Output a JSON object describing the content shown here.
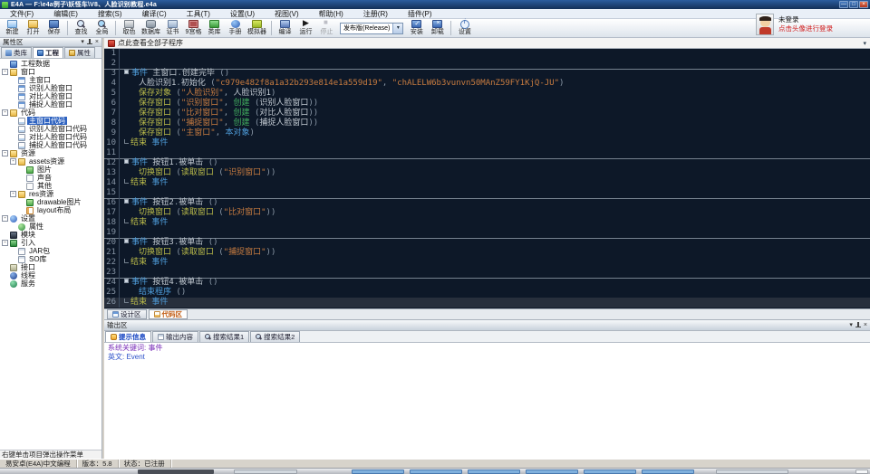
{
  "window": {
    "title": "E4A — F:\\e4a例子\\妖怪车\\V8、人脸识别教程.e4a"
  },
  "menu": {
    "items": [
      "文件(F)",
      "编辑(E)",
      "搜索(S)",
      "编译(C)",
      "工具(T)",
      "设置(U)",
      "视图(V)",
      "帮助(H)",
      "注册(R)",
      "插件(P)"
    ]
  },
  "toolbar": {
    "buttons": [
      {
        "label": "新建",
        "icon": "new"
      },
      {
        "label": "打开",
        "icon": "open"
      },
      {
        "label": "保存",
        "icon": "save"
      },
      {
        "sep": true
      },
      {
        "label": "查找",
        "icon": "find"
      },
      {
        "label": "全局",
        "icon": "global"
      },
      {
        "sep": true
      },
      {
        "label": "取色",
        "icon": "color"
      },
      {
        "label": "数据库",
        "icon": "db"
      },
      {
        "label": "证书",
        "icon": "cert"
      },
      {
        "label": "9宫格",
        "icon": "grid9"
      },
      {
        "label": "类库",
        "icon": "lib"
      },
      {
        "label": "手册",
        "icon": "manual"
      },
      {
        "label": "模拟器",
        "icon": "emu"
      },
      {
        "sep": true
      },
      {
        "label": "编译",
        "icon": "build"
      },
      {
        "label": "运行",
        "icon": "run"
      },
      {
        "label": "停止",
        "icon": "stop",
        "disabled": true
      },
      {
        "type": "select",
        "value": "发布版(Release)"
      },
      {
        "label": "安装",
        "icon": "install"
      },
      {
        "label": "卸载",
        "icon": "uninstall"
      },
      {
        "sep": true
      },
      {
        "label": "设置",
        "icon": "settings"
      }
    ]
  },
  "account": {
    "status": "未登录",
    "hint": "点击头像进行登录"
  },
  "sidebar": {
    "panel_title": "属性区",
    "tabs": [
      {
        "label": "类库",
        "icon": "lib"
      },
      {
        "label": "工程",
        "icon": "proj",
        "active": true
      },
      {
        "label": "属性",
        "icon": "prop"
      }
    ],
    "tree": [
      {
        "d": 0,
        "icon": "app",
        "label": "工程数据"
      },
      {
        "d": 0,
        "exp": true,
        "icon": "folder",
        "label": "窗口"
      },
      {
        "d": 1,
        "icon": "form",
        "label": "主窗口"
      },
      {
        "d": 1,
        "icon": "form",
        "label": "识别人脸窗口"
      },
      {
        "d": 1,
        "icon": "form",
        "label": "对比人脸窗口"
      },
      {
        "d": 1,
        "icon": "form",
        "label": "捕捉人脸窗口"
      },
      {
        "d": 0,
        "exp": true,
        "icon": "folder",
        "label": "代码"
      },
      {
        "d": 1,
        "icon": "code",
        "label": "主窗口代码",
        "selected": true
      },
      {
        "d": 1,
        "icon": "code",
        "label": "识别人脸窗口代码"
      },
      {
        "d": 1,
        "icon": "code",
        "label": "对比人脸窗口代码"
      },
      {
        "d": 1,
        "icon": "code",
        "label": "捕捉人脸窗口代码"
      },
      {
        "d": 0,
        "exp": true,
        "icon": "folder",
        "label": "资源"
      },
      {
        "d": 1,
        "exp": true,
        "icon": "folder",
        "label": "assets资源"
      },
      {
        "d": 2,
        "icon": "img",
        "label": "图片"
      },
      {
        "d": 2,
        "icon": "sound",
        "label": "声音"
      },
      {
        "d": 2,
        "icon": "file",
        "label": "其他"
      },
      {
        "d": 1,
        "exp": true,
        "icon": "folder",
        "label": "res资源"
      },
      {
        "d": 2,
        "icon": "img",
        "label": "drawable图片"
      },
      {
        "d": 2,
        "icon": "layout",
        "label": "layout布局"
      },
      {
        "d": 0,
        "exp": true,
        "icon": "info",
        "label": "设置"
      },
      {
        "d": 1,
        "icon": "gear",
        "label": "属性"
      },
      {
        "d": 0,
        "icon": "module",
        "label": "模块"
      },
      {
        "d": 0,
        "exp": true,
        "icon": "import",
        "label": "引入"
      },
      {
        "d": 1,
        "icon": "jar",
        "label": "JAR包"
      },
      {
        "d": 1,
        "icon": "so",
        "label": "SO库"
      },
      {
        "d": 0,
        "icon": "iface",
        "label": "接口"
      },
      {
        "d": 0,
        "icon": "thread",
        "label": "线程"
      },
      {
        "d": 0,
        "icon": "service",
        "label": "服务"
      }
    ],
    "footer_hint": "右键单击项目弹出操作菜单"
  },
  "editor": {
    "tab_title": "点此查看全部子程序",
    "bottom_tabs": [
      {
        "label": "设计区",
        "icon": "design"
      },
      {
        "label": "代码区",
        "icon": "code",
        "active": true
      }
    ],
    "lines": [
      {
        "n": 1
      },
      {
        "n": 2
      },
      {
        "n": 3,
        "b": true,
        "t": [
          [
            "box",
            ""
          ],
          [
            "ev",
            "事件 "
          ],
          [
            "id",
            "主窗口"
          ],
          [
            "pn",
            "."
          ],
          [
            "id",
            "创建完毕 "
          ],
          [
            "pn",
            "()"
          ]
        ]
      },
      {
        "n": 4,
        "i": 1,
        "t": [
          [
            "id",
            "人脸识别1"
          ],
          [
            "pn",
            "."
          ],
          [
            "id",
            "初始化 "
          ],
          [
            "pn",
            "("
          ],
          [
            "str",
            "\"c979e482f8a1a32b293e814e1a559d19\""
          ],
          [
            "pn",
            ", "
          ],
          [
            "str",
            "\"chALELW6b3vunvn50MAnZ59FY1KjQ-JU\""
          ],
          [
            "pn",
            ")"
          ]
        ]
      },
      {
        "n": 5,
        "i": 1,
        "t": [
          [
            "fn",
            "保存对象 "
          ],
          [
            "pn",
            "("
          ],
          [
            "str",
            "\"人脸识别\""
          ],
          [
            "pn",
            ", "
          ],
          [
            "id",
            "人脸识别1"
          ],
          [
            "pn",
            ")"
          ]
        ]
      },
      {
        "n": 6,
        "i": 1,
        "t": [
          [
            "fn",
            "保存窗口 "
          ],
          [
            "pn",
            "("
          ],
          [
            "str",
            "\"识别窗口\""
          ],
          [
            "pn",
            ", "
          ],
          [
            "grn",
            "创建 "
          ],
          [
            "pn",
            "("
          ],
          [
            "id",
            "识别人脸窗口"
          ],
          [
            "pn",
            "))"
          ]
        ]
      },
      {
        "n": 7,
        "i": 1,
        "t": [
          [
            "fn",
            "保存窗口 "
          ],
          [
            "pn",
            "("
          ],
          [
            "str",
            "\"比对窗口\""
          ],
          [
            "pn",
            ", "
          ],
          [
            "grn",
            "创建 "
          ],
          [
            "pn",
            "("
          ],
          [
            "id",
            "对比人脸窗口"
          ],
          [
            "pn",
            "))"
          ]
        ]
      },
      {
        "n": 8,
        "i": 1,
        "t": [
          [
            "fn",
            "保存窗口 "
          ],
          [
            "pn",
            "("
          ],
          [
            "str",
            "\"捕捉窗口\""
          ],
          [
            "pn",
            ", "
          ],
          [
            "grn",
            "创建 "
          ],
          [
            "pn",
            "("
          ],
          [
            "id",
            "捕捉人脸窗口"
          ],
          [
            "pn",
            "))"
          ]
        ]
      },
      {
        "n": 9,
        "i": 1,
        "t": [
          [
            "fn",
            "保存窗口 "
          ],
          [
            "pn",
            "("
          ],
          [
            "str",
            "\"主窗口\""
          ],
          [
            "pn",
            ", "
          ],
          [
            "kw",
            "本对象"
          ],
          [
            "pn",
            ")"
          ]
        ]
      },
      {
        "n": 10,
        "t": [
          [
            "conn",
            ""
          ],
          [
            "fn",
            "结束 "
          ],
          [
            "ev",
            "事件"
          ]
        ]
      },
      {
        "n": 11
      },
      {
        "n": 12,
        "b": true,
        "t": [
          [
            "box",
            ""
          ],
          [
            "ev",
            "事件 "
          ],
          [
            "id",
            "按钮1"
          ],
          [
            "pn",
            "."
          ],
          [
            "id",
            "被单击 "
          ],
          [
            "pn",
            "()"
          ]
        ]
      },
      {
        "n": 13,
        "i": 1,
        "t": [
          [
            "fn",
            "切换窗口 "
          ],
          [
            "pn",
            "("
          ],
          [
            "fn",
            "读取窗口 "
          ],
          [
            "pn",
            "("
          ],
          [
            "str",
            "\"识别窗口\""
          ],
          [
            "pn",
            "))"
          ]
        ]
      },
      {
        "n": 14,
        "t": [
          [
            "conn",
            ""
          ],
          [
            "fn",
            "结束 "
          ],
          [
            "ev",
            "事件"
          ]
        ]
      },
      {
        "n": 15
      },
      {
        "n": 16,
        "b": true,
        "t": [
          [
            "box",
            ""
          ],
          [
            "ev",
            "事件 "
          ],
          [
            "id",
            "按钮2"
          ],
          [
            "pn",
            "."
          ],
          [
            "id",
            "被单击 "
          ],
          [
            "pn",
            "()"
          ]
        ]
      },
      {
        "n": 17,
        "i": 1,
        "t": [
          [
            "fn",
            "切换窗口 "
          ],
          [
            "pn",
            "("
          ],
          [
            "fn",
            "读取窗口 "
          ],
          [
            "pn",
            "("
          ],
          [
            "str",
            "\"比对窗口\""
          ],
          [
            "pn",
            "))"
          ]
        ]
      },
      {
        "n": 18,
        "t": [
          [
            "conn",
            ""
          ],
          [
            "fn",
            "结束 "
          ],
          [
            "ev",
            "事件"
          ]
        ]
      },
      {
        "n": 19
      },
      {
        "n": 20,
        "b": true,
        "t": [
          [
            "box",
            ""
          ],
          [
            "ev",
            "事件 "
          ],
          [
            "id",
            "按钮3"
          ],
          [
            "pn",
            "."
          ],
          [
            "id",
            "被单击 "
          ],
          [
            "pn",
            "()"
          ]
        ]
      },
      {
        "n": 21,
        "i": 1,
        "t": [
          [
            "fn",
            "切换窗口 "
          ],
          [
            "pn",
            "("
          ],
          [
            "fn",
            "读取窗口 "
          ],
          [
            "pn",
            "("
          ],
          [
            "str",
            "\"捕捉窗口\""
          ],
          [
            "pn",
            "))"
          ]
        ]
      },
      {
        "n": 22,
        "t": [
          [
            "conn",
            ""
          ],
          [
            "fn",
            "结束 "
          ],
          [
            "ev",
            "事件"
          ]
        ]
      },
      {
        "n": 23
      },
      {
        "n": 24,
        "b": true,
        "t": [
          [
            "box",
            ""
          ],
          [
            "ev",
            "事件 "
          ],
          [
            "id",
            "按钮4"
          ],
          [
            "pn",
            "."
          ],
          [
            "id",
            "被单击 "
          ],
          [
            "pn",
            "()"
          ]
        ]
      },
      {
        "n": 25,
        "i": 1,
        "t": [
          [
            "kw",
            "结束程序 "
          ],
          [
            "pn",
            "()"
          ]
        ]
      },
      {
        "n": 26,
        "cur": true,
        "t": [
          [
            "conn",
            ""
          ],
          [
            "fn",
            "结束 "
          ],
          [
            "ev",
            "事件"
          ]
        ]
      }
    ]
  },
  "output": {
    "panel_title": "输出区",
    "tabs": [
      {
        "label": "提示信息",
        "icon": "hint",
        "active": true
      },
      {
        "label": "输出内容",
        "icon": "content"
      },
      {
        "label": "搜索结果1",
        "icon": "search"
      },
      {
        "label": "搜索结果2",
        "icon": "search"
      }
    ],
    "lines": [
      "系统关键词: 事件",
      "英文: Event"
    ]
  },
  "statusbar": {
    "app_name": "易安卓(E4A)中文编程",
    "version": "版本：5.8",
    "status": "状态：已注册"
  },
  "colors": {
    "accent_selection": "#2f63c0",
    "editor_background": "#0d1828",
    "keyword_blue": "#4f9edc",
    "function_yellow": "#bcbc4a",
    "string_orange": "#c87c40",
    "create_green": "#42b060",
    "login_hint_red": "#d01818"
  }
}
